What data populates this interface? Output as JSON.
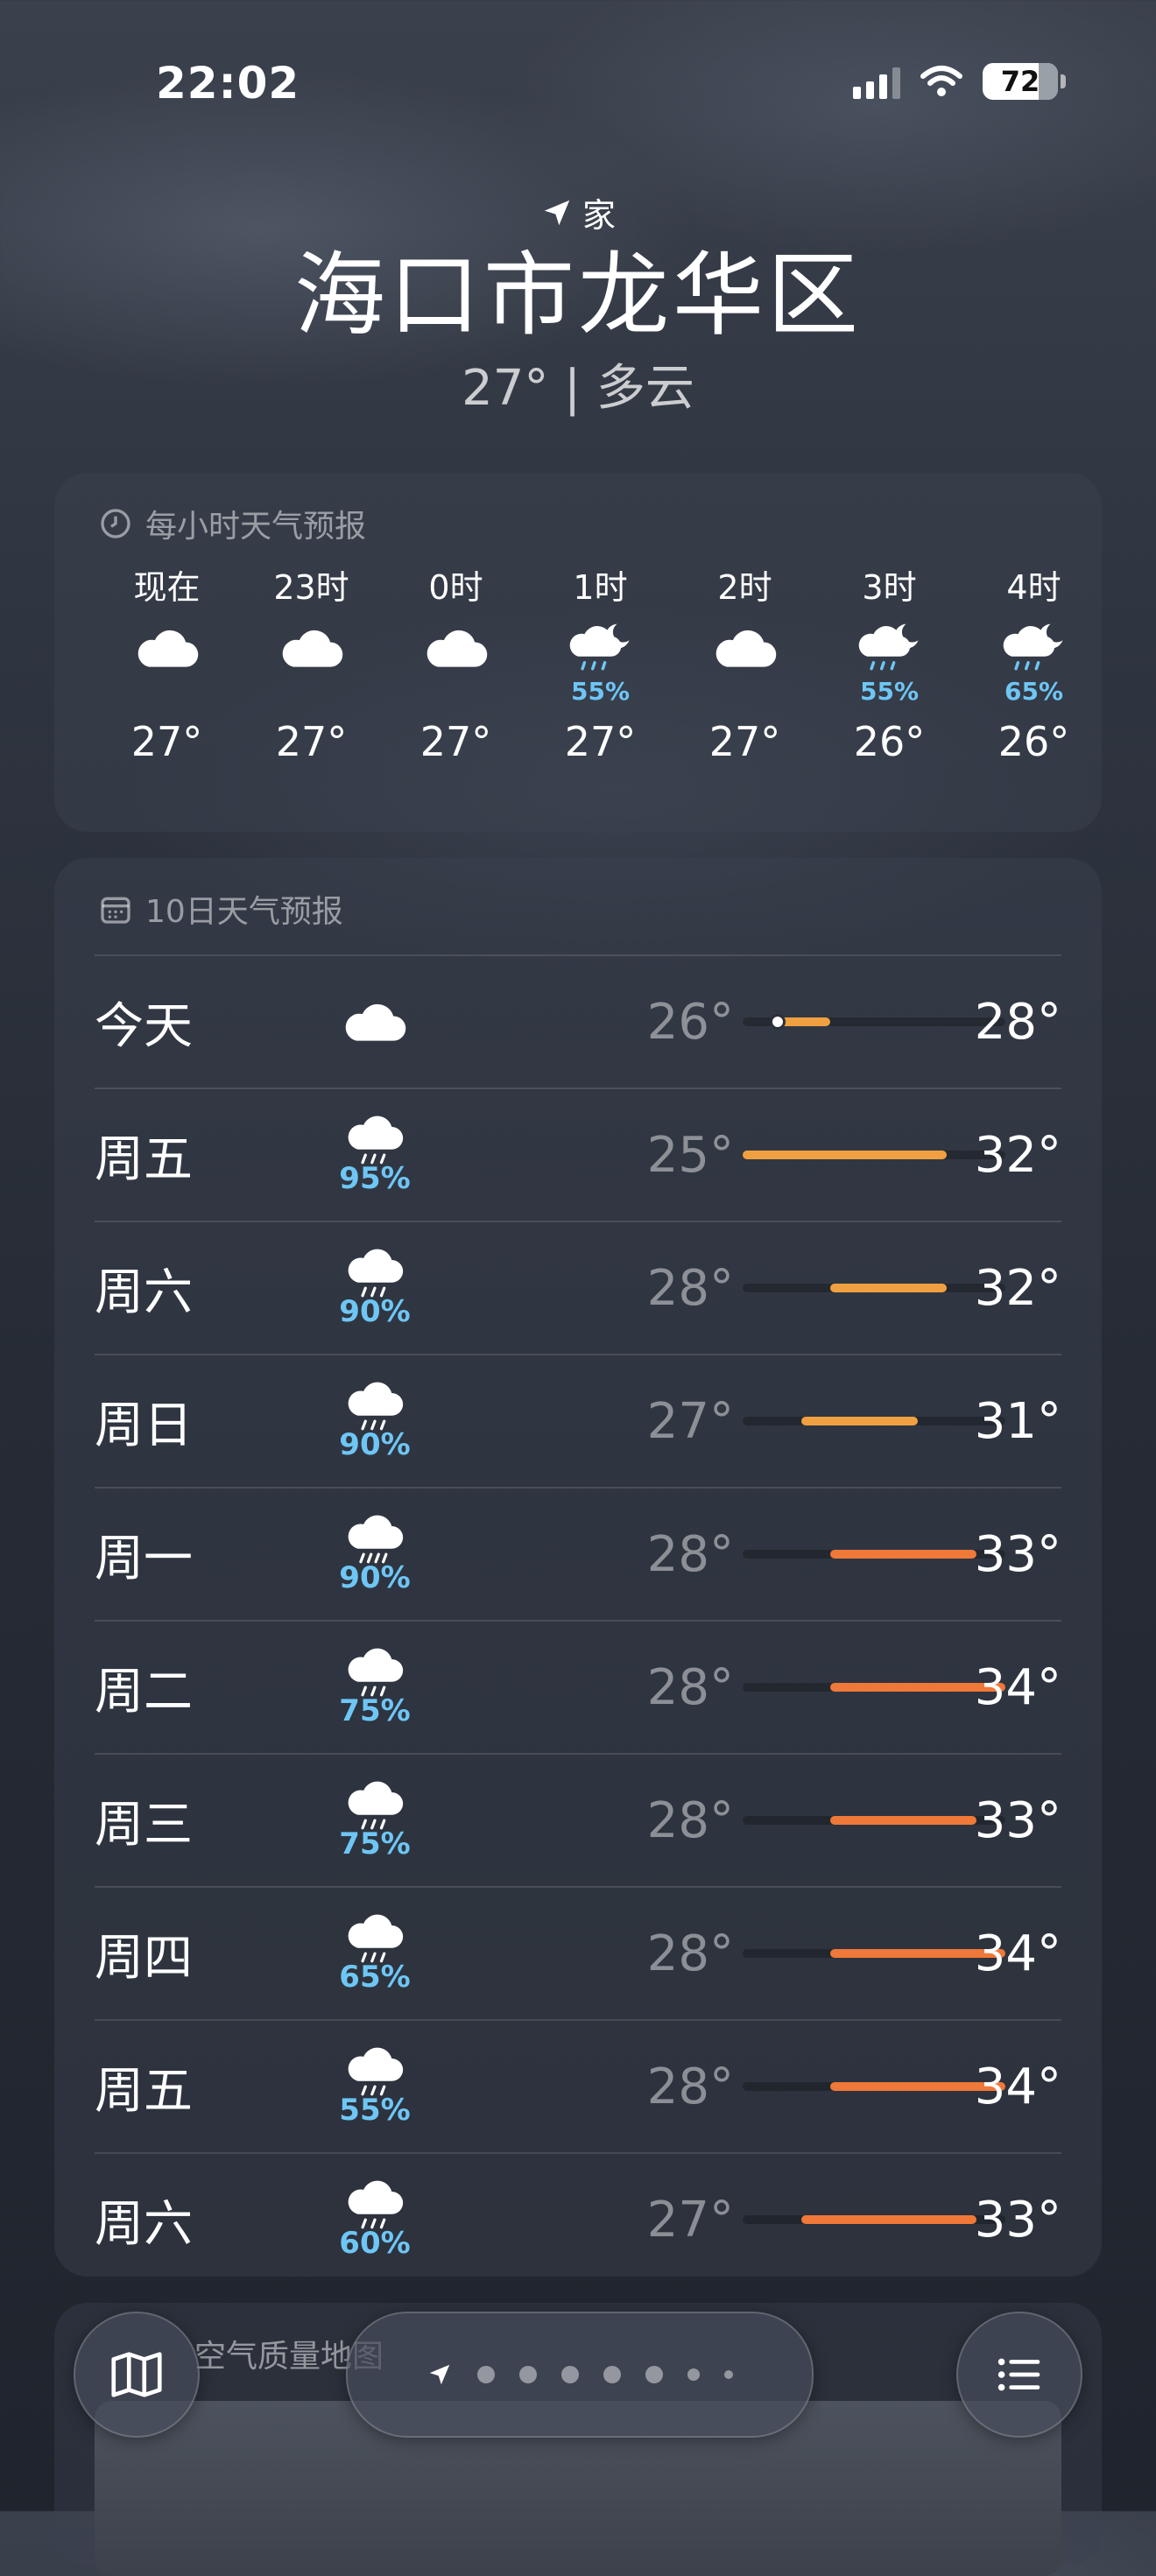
{
  "status_bar": {
    "time": "22:02",
    "battery": "72"
  },
  "header": {
    "location_label": "家",
    "city": "海口市龙华区",
    "current": "27° | 多云"
  },
  "hourly": {
    "title": "每小时天气预报",
    "items": [
      {
        "label": "现在",
        "icon": "cloud-icon",
        "precip": "",
        "temp": "27°"
      },
      {
        "label": "23时",
        "icon": "cloud-icon",
        "precip": "",
        "temp": "27°"
      },
      {
        "label": "0时",
        "icon": "cloud-icon",
        "precip": "",
        "temp": "27°"
      },
      {
        "label": "1时",
        "icon": "moon-rain-icon",
        "precip": "55%",
        "temp": "27°"
      },
      {
        "label": "2时",
        "icon": "cloud-icon",
        "precip": "",
        "temp": "27°"
      },
      {
        "label": "3时",
        "icon": "moon-rain-icon",
        "precip": "55%",
        "temp": "26°"
      },
      {
        "label": "4时",
        "icon": "moon-rain-icon",
        "precip": "65%",
        "temp": "26°"
      }
    ]
  },
  "daily": {
    "title": "10日天气预报",
    "range_min": 25,
    "range_max": 34,
    "days": [
      {
        "name": "今天",
        "icon": "cloud-icon",
        "precip": "",
        "low": "26°",
        "high": "28°",
        "low_val": 26,
        "high_val": 28,
        "current_val": 26.2
      },
      {
        "name": "周五",
        "icon": "rain-icon",
        "precip": "95%",
        "low": "25°",
        "high": "32°",
        "low_val": 25,
        "high_val": 32
      },
      {
        "name": "周六",
        "icon": "rain-icon",
        "precip": "90%",
        "low": "28°",
        "high": "32°",
        "low_val": 28,
        "high_val": 32
      },
      {
        "name": "周日",
        "icon": "rain-icon",
        "precip": "90%",
        "low": "27°",
        "high": "31°",
        "low_val": 27,
        "high_val": 31
      },
      {
        "name": "周一",
        "icon": "heavy-rain-icon",
        "precip": "90%",
        "low": "28°",
        "high": "33°",
        "low_val": 28,
        "high_val": 33
      },
      {
        "name": "周二",
        "icon": "rain-icon",
        "precip": "75%",
        "low": "28°",
        "high": "34°",
        "low_val": 28,
        "high_val": 34
      },
      {
        "name": "周三",
        "icon": "rain-icon",
        "precip": "75%",
        "low": "28°",
        "high": "33°",
        "low_val": 28,
        "high_val": 33
      },
      {
        "name": "周四",
        "icon": "rain-icon",
        "precip": "65%",
        "low": "28°",
        "high": "34°",
        "low_val": 28,
        "high_val": 34
      },
      {
        "name": "周五",
        "icon": "rain-icon",
        "precip": "55%",
        "low": "28°",
        "high": "34°",
        "low_val": 28,
        "high_val": 34
      },
      {
        "name": "周六",
        "icon": "rain-icon",
        "precip": "60%",
        "low": "27°",
        "high": "33°",
        "low_val": 27,
        "high_val": 33
      }
    ]
  },
  "air_quality": {
    "title": "空气质量地图"
  },
  "colors": {
    "precip": "#6ec6f5",
    "bar_warm": "#f0a040",
    "bar_hot": "#f07838"
  }
}
